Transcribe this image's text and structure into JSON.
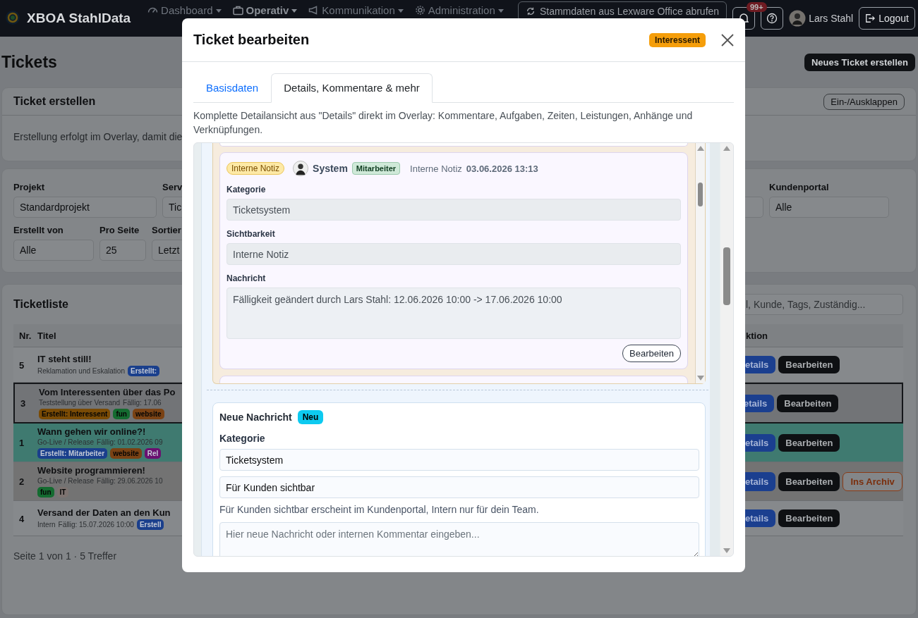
{
  "navbar": {
    "brand": "XBOA StahlData",
    "menu": [
      {
        "label": "Dashboard",
        "selected": false
      },
      {
        "label": "Operativ",
        "selected": true
      },
      {
        "label": "Kommunikation",
        "selected": false
      },
      {
        "label": "Administration",
        "selected": false
      }
    ],
    "sync_button": "Stammdaten aus Lexware Office abrufen",
    "notification_count": "99+",
    "user_name": "Lars Stahl",
    "logout_button": "Logout"
  },
  "page": {
    "title": "Tickets",
    "new_ticket_button": "Neues Ticket erstellen"
  },
  "create_card": {
    "title": "Ticket erstellen",
    "toggle_button": "Ein-/Ausklappen",
    "text": "Erstellung erfolgt im Overlay, damit die"
  },
  "filters": {
    "row_1": [
      {
        "label": "Projekt",
        "value": "Standardprojekt"
      },
      {
        "label": "Serv",
        "value": "Tic"
      }
    ],
    "right": {
      "label": "Kundenportal",
      "value": "Alle"
    },
    "row_2": [
      {
        "label": "Erstellt von",
        "value": "Alle"
      },
      {
        "label": "Pro Seite",
        "value": "25"
      },
      {
        "label": "Sortier",
        "value": "Letzt"
      }
    ]
  },
  "ticket_list": {
    "title": "Ticketliste",
    "search_placeholder": "l, Kunde, Tags, Zuständig...",
    "columns": [
      "Nr.",
      "Titel",
      "ktion"
    ],
    "rows": [
      {
        "nr": "5",
        "title": "IT steht still!",
        "category": "Reklamation und Eskalation",
        "kind": "inline",
        "color": "#86898c",
        "selected": false,
        "tags": [
          {
            "label": "Erstellt:",
            "color": "#1a3f8c"
          }
        ],
        "actions": [
          "etails",
          "Bearbeiten"
        ]
      },
      {
        "nr": "3",
        "title": "Vom Interessenten über das Po",
        "category": "Teststellung über Versand",
        "due": "Fällig: 17.06",
        "kind": "stacked",
        "color": "#727477",
        "selected": true,
        "tags": [
          {
            "label": "Erstellt: Interessent",
            "color": "#7a4b05"
          },
          {
            "label": "fun",
            "color": "#146b30"
          },
          {
            "label": "website",
            "color": "#7a4214"
          }
        ],
        "actions": [
          "etails",
          "Bearbeiten"
        ]
      },
      {
        "nr": "1",
        "title": "Wann gehen wir online?!",
        "category": "Go-Live / Release",
        "due": "Fällig: 01.02.2026 09",
        "kind": "stacked",
        "color": "#3f7a70",
        "selected": false,
        "tags": [
          {
            "label": "Erstellt: Mitarbeiter",
            "color": "#1a3f8c"
          },
          {
            "label": "website",
            "color": "#7a4214"
          },
          {
            "label": "Rel",
            "color": "#6a1070"
          }
        ],
        "actions": [
          "etails",
          "Bearbeiten"
        ]
      },
      {
        "nr": "2",
        "title": "Website programmieren!",
        "category": "Go-Live / Release",
        "due": "Fällig: 29.06.2026 10",
        "kind": "stacked",
        "color": "#737373",
        "selected": false,
        "tags": [
          {
            "label": "fun",
            "color": "#146b30"
          },
          {
            "label": "IT",
            "color": "#7d7370"
          }
        ],
        "actions": [
          "etails",
          "Bearbeiten",
          "Ins Archiv"
        ]
      },
      {
        "nr": "4",
        "title": "Versand der Daten an den Kun",
        "category": "Intern",
        "due": "Fällig: 15.07.2026 10:00",
        "kind": "inline",
        "color": "#86898c",
        "selected": false,
        "tags": [
          {
            "label": "Erstell",
            "color": "#1a3f8c"
          }
        ],
        "actions": [
          "etails",
          "Bearbeiten"
        ]
      }
    ],
    "pagination": "Seite 1 von 1 · 5 Treffer"
  },
  "modal": {
    "title": "Ticket bearbeiten",
    "status_badge": "Interessent",
    "tabs": [
      {
        "label": "Basisdaten",
        "selected": false
      },
      {
        "label": "Details, Kommentare & mehr",
        "selected": true
      }
    ],
    "description": "Komplette Detailansicht aus \"Details\" direkt im Overlay: Kommentare, Aufgaben, Zeiten, Leistungen, Anhänge und Verknüpfungen.",
    "comment": {
      "type_badge": "Interne Notiz",
      "author": "System",
      "role_badge": "Mitarbeiter",
      "visibility": "Interne Notiz",
      "timestamp": "03.06.2026 13:13",
      "fields": [
        {
          "label": "Kategorie",
          "value": "Ticketsystem",
          "kind": "select",
          "disabled": true
        },
        {
          "label": "Sichtbarkeit",
          "value": "Interne Notiz",
          "kind": "select",
          "disabled": true
        },
        {
          "label": "Nachricht",
          "value": "Fälligkeit geändert durch Lars Stahl: 12.06.2026 10:00 -> 17.06.2026 10:00",
          "kind": "textarea",
          "disabled": true
        }
      ],
      "edit_button": "Bearbeiten"
    },
    "new_message": {
      "title": "Neue Nachricht",
      "badge": "Neu",
      "category_label": "Kategorie",
      "category_value": "Ticketsystem",
      "visibility_value": "Für Kunden sichtbar",
      "help_text": "Für Kunden sichtbar erscheint im Kundenportal, Intern nur für dein Team.",
      "message_placeholder": "Hier neue Nachricht oder internen Kommentar eingeben..."
    }
  }
}
